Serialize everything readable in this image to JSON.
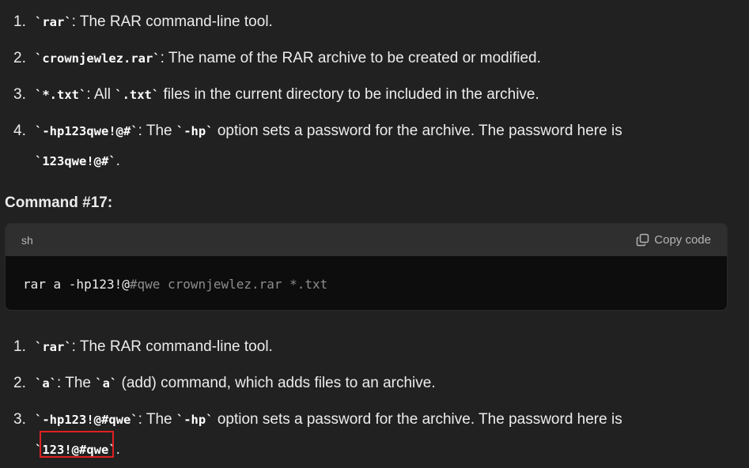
{
  "list1": [
    {
      "num": "1.",
      "code": "`rar`",
      "text": ": The RAR command-line tool."
    },
    {
      "num": "2.",
      "code": "`crownjewlez.rar`",
      "text": ": The name of the RAR archive to be created or modified."
    },
    {
      "num": "3.",
      "code": "`*.txt`",
      "text_a": ": All ",
      "code2": "`.txt`",
      "text_b": " files in the current directory to be included in the archive."
    },
    {
      "num": "4.",
      "code": "`-hp123qwe!@#`",
      "text_a": ": The ",
      "code2": "`-hp`",
      "text_b": " option sets a password for the archive. The password here is ",
      "code3": "`123qwe!@#`",
      "text_c": "."
    }
  ],
  "heading": "Command #17:",
  "codeblock": {
    "language": "sh",
    "copy_label": "Copy code",
    "copy_icon": "copy-icon",
    "code_part1": "rar a -hp123!@",
    "code_part2": "#qwe crownjewlez.rar *.txt"
  },
  "list2": [
    {
      "num": "1.",
      "code": "`rar`",
      "text": ": The RAR command-line tool."
    },
    {
      "num": "2.",
      "code": "`a`",
      "text_a": ": The ",
      "code2": "`a`",
      "text_b": " (add) command, which adds files to an archive."
    },
    {
      "num": "3.",
      "code": "`-hp123!@#qwe`",
      "text_a": ": The ",
      "code2": "`-hp`",
      "text_b": " option sets a password for the archive. The password here is ",
      "code3": "`123!@#qwe`",
      "text_c": "."
    }
  ],
  "colors": {
    "background": "#212121",
    "code_header": "#2f2f2f",
    "code_body": "#0d0d0d",
    "highlight": "#e02020"
  }
}
